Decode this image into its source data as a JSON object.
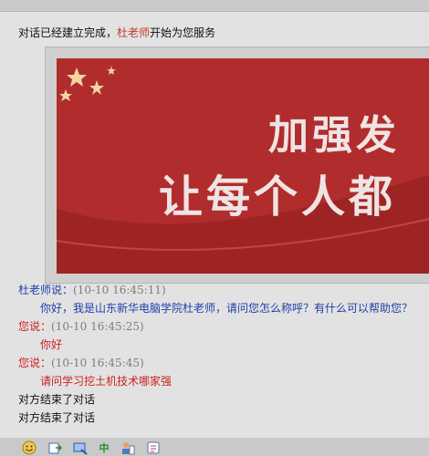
{
  "system": {
    "prefix": "对话已经建立完成，",
    "agent": "杜老师",
    "suffix": "开始为您服务"
  },
  "banner": {
    "line1": "加强发",
    "line2": "让每个人都"
  },
  "messages": [
    {
      "speaker": "杜老师说：",
      "time": "(10-10 16:45:11)",
      "text": "你好，我是山东新华电脑学院杜老师，请问您怎么称呼？有什么可以帮助您？"
    },
    {
      "speaker": "您说：",
      "time": "(10-10 16:45:25)",
      "text": "你好"
    },
    {
      "speaker": "您说：",
      "time": "(10-10 16:45:45)",
      "text": "请问学习挖土机技术哪家强"
    }
  ],
  "end_notices": [
    "对方结束了对话",
    "对方结束了对话"
  ],
  "toolbar": {
    "icons": [
      "smiley-icon",
      "send-file-icon",
      "screenshot-icon",
      "ime-icon",
      "contacts-icon",
      "history-icon"
    ],
    "ime_glyph": "中"
  },
  "colors": {
    "agent": "#1f3fa8",
    "me": "#cc2020",
    "banner": "#b12c2c"
  }
}
